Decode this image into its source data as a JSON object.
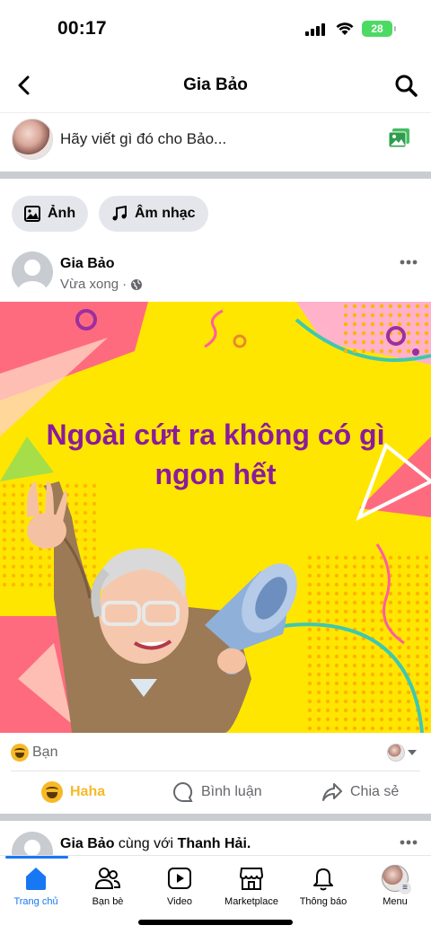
{
  "status_bar": {
    "time": "00:17",
    "battery": "28"
  },
  "header": {
    "title": "Gia Bảo"
  },
  "composer": {
    "placeholder": "Hãy viết gì đó cho Bảo..."
  },
  "chips": [
    {
      "label": "Ảnh",
      "icon": "photo-icon"
    },
    {
      "label": "Âm nhạc",
      "icon": "music-note-icon"
    }
  ],
  "post": {
    "author": "Gia Bảo",
    "time": "Vừa xong",
    "privacy_icon": "globe-icon",
    "image_text_line1": "Ngoài cứt ra không có gì",
    "image_text_line2": "ngon hết",
    "reaction_summary": "Bạn",
    "reaction_icon": "haha-emoji",
    "actions": [
      {
        "label": "Haha",
        "icon": "haha-icon",
        "active": true
      },
      {
        "label": "Bình luận",
        "icon": "comment-icon",
        "active": false
      },
      {
        "label": "Chia sẻ",
        "icon": "share-icon",
        "active": false
      }
    ]
  },
  "next_post": {
    "author": "Gia Bảo",
    "connector": "cùng với",
    "tagged": "Thanh Hải."
  },
  "bottom_nav": [
    {
      "label": "Trang chủ",
      "icon": "home-icon",
      "active": true
    },
    {
      "label": "Bạn bè",
      "icon": "friends-icon",
      "active": false
    },
    {
      "label": "Video",
      "icon": "video-icon",
      "active": false
    },
    {
      "label": "Marketplace",
      "icon": "marketplace-icon",
      "active": false
    },
    {
      "label": "Thông báo",
      "icon": "bell-icon",
      "active": false
    },
    {
      "label": "Menu",
      "icon": "menu-avatar",
      "active": false
    }
  ],
  "colors": {
    "accent": "#1877f2",
    "haha": "#f7b928",
    "image_bg": "#ffe600",
    "image_text": "#8b1b9c"
  }
}
